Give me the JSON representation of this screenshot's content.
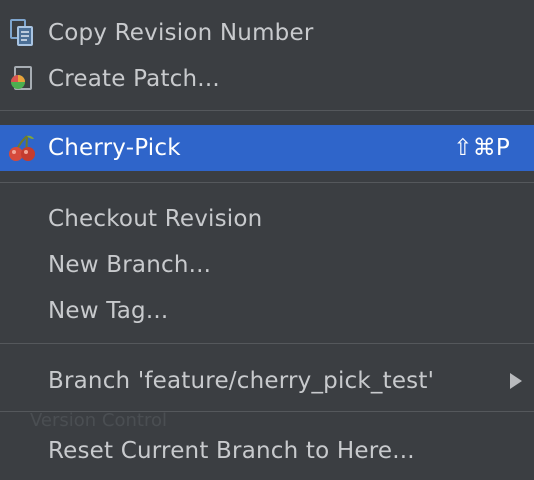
{
  "menu": {
    "copy_revision": {
      "label": "Copy Revision Number",
      "icon": "copy-icon"
    },
    "create_patch": {
      "label": "Create Patch...",
      "icon": "patch-icon"
    },
    "cherry_pick": {
      "label": "Cherry-Pick",
      "shortcut": "⇧⌘P",
      "icon": "cherry-icon"
    },
    "checkout_revision": {
      "label": "Checkout Revision"
    },
    "new_branch": {
      "label": "New Branch..."
    },
    "new_tag": {
      "label": "New Tag..."
    },
    "branch_submenu": {
      "label": "Branch 'feature/cherry_pick_test'",
      "icon": "chevron-right-icon"
    },
    "reset_branch": {
      "label": "Reset Current Branch to Here..."
    }
  },
  "background_panel": {
    "label": "Version Control"
  },
  "colors": {
    "menu_background": "#3b3e42",
    "selection": "#2f65ca",
    "text": "#c8cacd",
    "separator": "#55585c"
  }
}
